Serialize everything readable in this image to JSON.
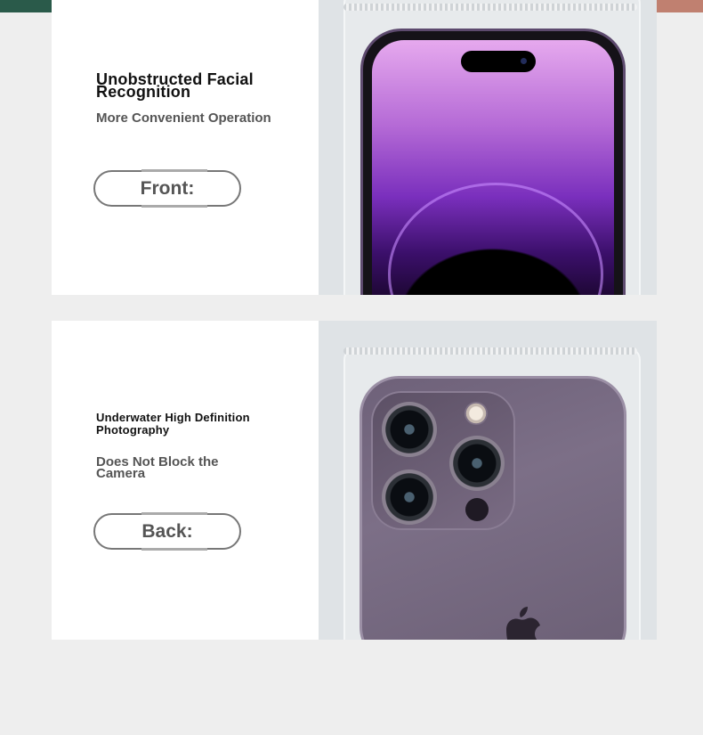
{
  "front": {
    "title": "Unobstructed Facial Recognition",
    "subtitle": "More Convenient Operation",
    "button_label": "Front:"
  },
  "back": {
    "title": "Underwater High Definition Photography",
    "subtitle": "Does Not Block the Camera",
    "button_label": "Back:"
  },
  "colors": {
    "panel": "#ffffff",
    "page": "#eeeeee",
    "phone_back": "#7c6f87",
    "screen_purple": "#7a2fbd"
  }
}
